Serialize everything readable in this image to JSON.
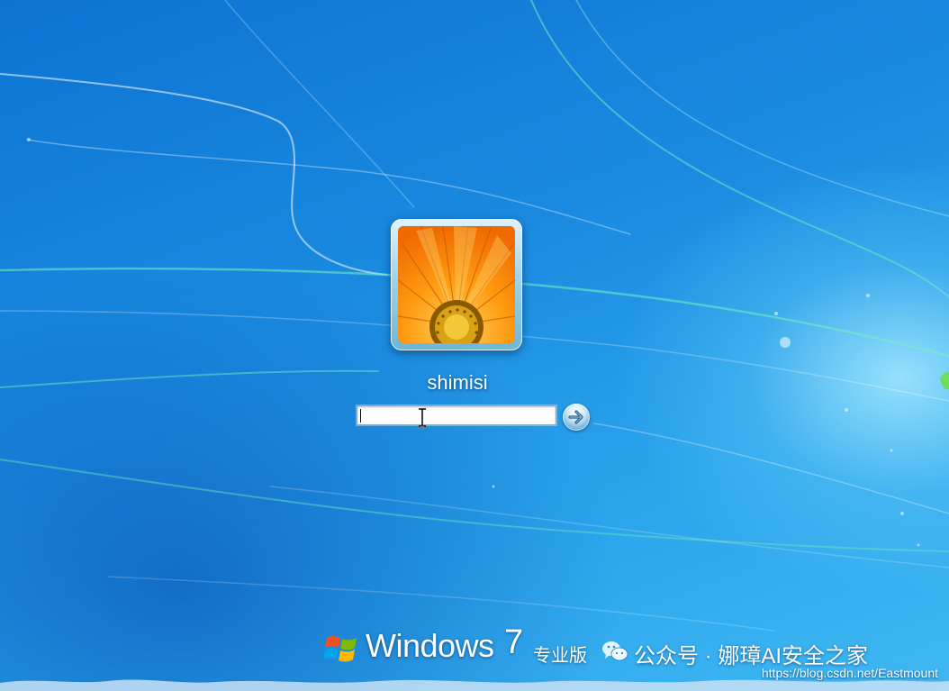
{
  "login": {
    "username": "shimisi",
    "password_value": "",
    "submit_icon": "arrow-right-icon"
  },
  "branding": {
    "windows_word": "Windows",
    "version": "7",
    "edition": "专业版"
  },
  "watermark": {
    "text": "公众号 · 娜璋AI安全之家",
    "url": "https://blog.csdn.net/Eastmount"
  },
  "colors": {
    "background": "#1a8ae0",
    "highlight": "#aaebff",
    "avatar_petals": "#ff8a00",
    "avatar_center": "#c88a00"
  }
}
